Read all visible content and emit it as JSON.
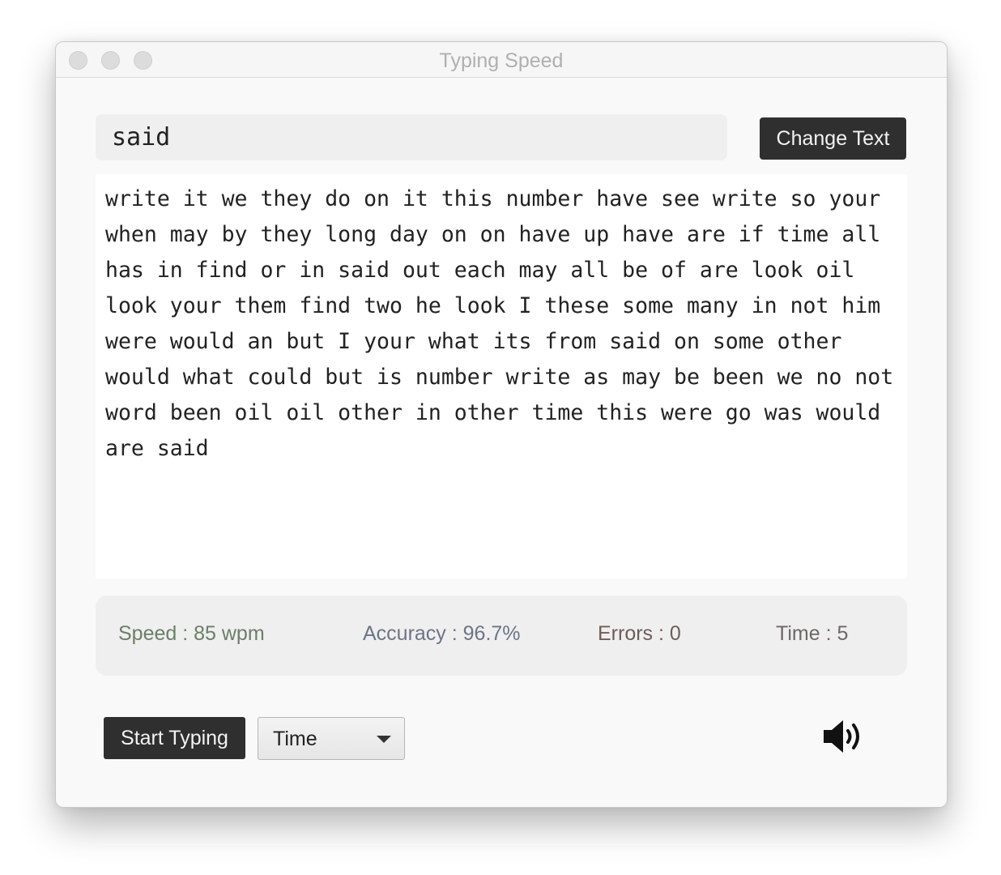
{
  "window": {
    "title": "Typing Speed"
  },
  "input": {
    "value": "said"
  },
  "buttons": {
    "change_text": "Change Text",
    "start_typing": "Start Typing"
  },
  "passage": {
    "text": "write it we they do on it this number have see write so your when may by they long day on on have up have are if time all has in find or in said out each may all be of are look oil look your them find two he look I these some many in not him were would an but I your what its from said on some other would what could but is number write as may be been we no not word been oil oil other in other time this were go was would are said"
  },
  "stats": {
    "speed": "Speed : 85 wpm",
    "accuracy": "Accuracy : 96.7%",
    "errors": "Errors : 0",
    "time": "Time : 5",
    "colors": {
      "speed": "#6b7f66",
      "accuracy": "#6d7488",
      "errors": "#6e5d58",
      "time": "#6c6866"
    }
  },
  "mode_select": {
    "selected": "Time"
  },
  "icons": {
    "sound": "speaker-volume-icon",
    "dropdown": "caret-down-icon"
  }
}
